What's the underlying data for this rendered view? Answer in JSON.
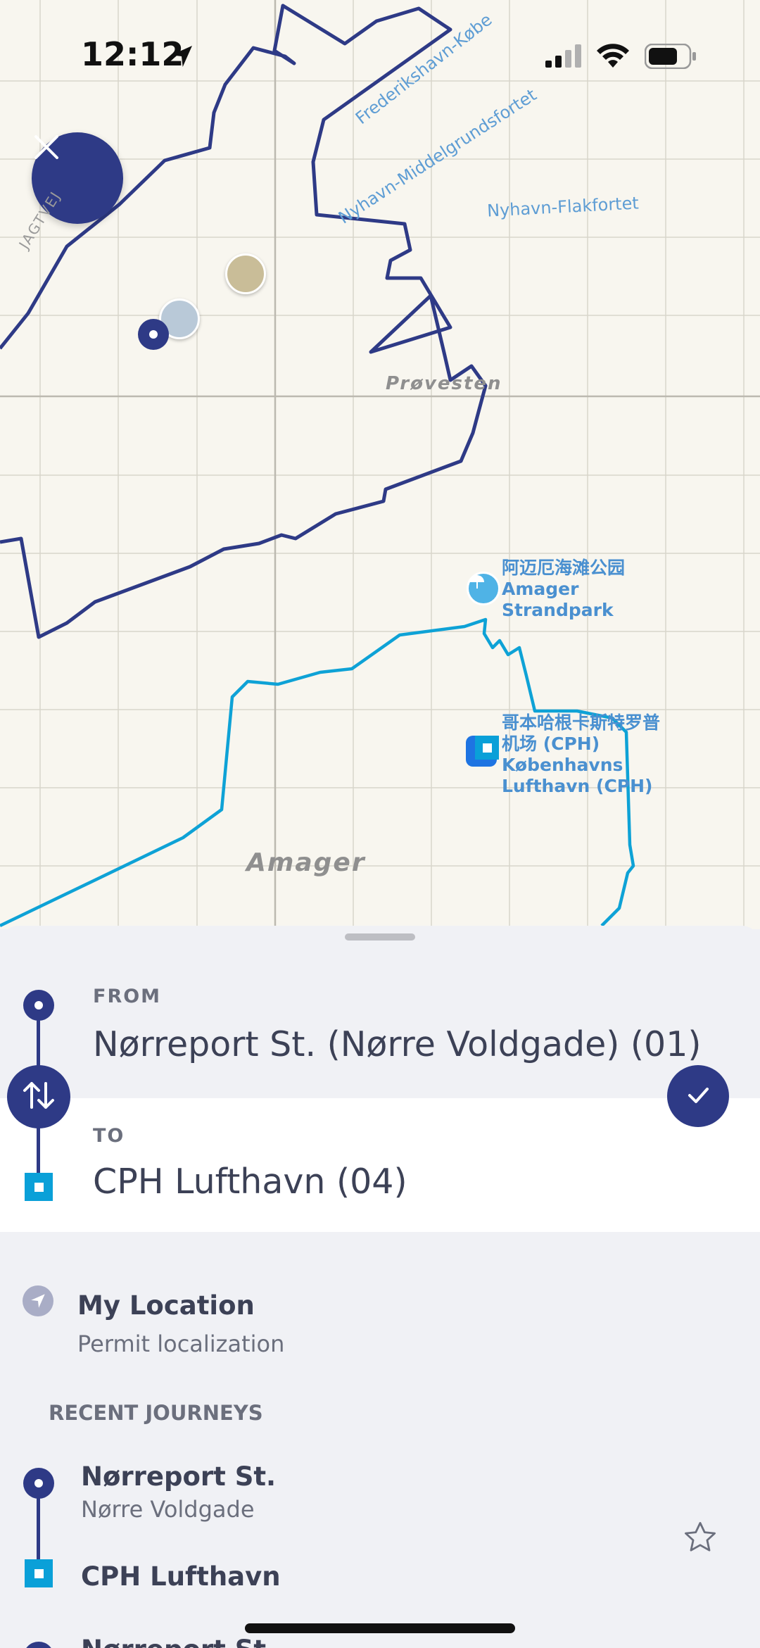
{
  "status_bar": {
    "time": "12:12",
    "location_icon": "location-arrow-icon",
    "signal_icon": "cellular-signal-icon",
    "wifi_icon": "wifi-icon",
    "battery_icon": "battery-icon"
  },
  "map": {
    "labels": {
      "jagtvej": "JAGTVEJ",
      "frederikshavn": "Frederikshavn-Købe",
      "nyhavn_middel": "Nyhavn-Middelgrundsfortet",
      "nyhavn_flak": "Nyhavn-Flakfortet",
      "provesten": "Prøvesten",
      "amager": "Amager"
    },
    "poi_beach": {
      "line1": "阿迈厄海滩公园",
      "line2": "Amager",
      "line3": "Strandpark",
      "icon": "beach-umbrella-icon"
    },
    "poi_airport": {
      "line1": "哥本哈根卡斯特罗普",
      "line2": "机场 (CPH)",
      "line3": "Københavns",
      "line4": "Lufthavn (CPH)",
      "icon": "airport-icon"
    },
    "colors": {
      "route_dark": "#2e3a86",
      "route_light": "#0ea2d6",
      "background": "#f8f6ef",
      "grid": "#d8d5cb"
    }
  },
  "close_button": {
    "icon": "close-icon"
  },
  "trip": {
    "from_label": "FROM",
    "from_value": "Nørreport St. (Nørre Voldgade) (01)",
    "to_label": "TO",
    "to_value": "CPH Lufthavn (04)",
    "swap_icon": "swap-arrows-icon",
    "confirm_icon": "checkmark-icon"
  },
  "my_location": {
    "title": "My Location",
    "subtitle": "Permit localization",
    "icon": "location-arrow-icon"
  },
  "recent": {
    "heading": "RECENT JOURNEYS",
    "items": [
      {
        "from_title": "Nørreport St.",
        "from_sub": "Nørre Voldgade",
        "to_title": "CPH Lufthavn",
        "star_icon": "star-outline-icon"
      },
      {
        "from_title": "Nørreport St."
      }
    ]
  }
}
